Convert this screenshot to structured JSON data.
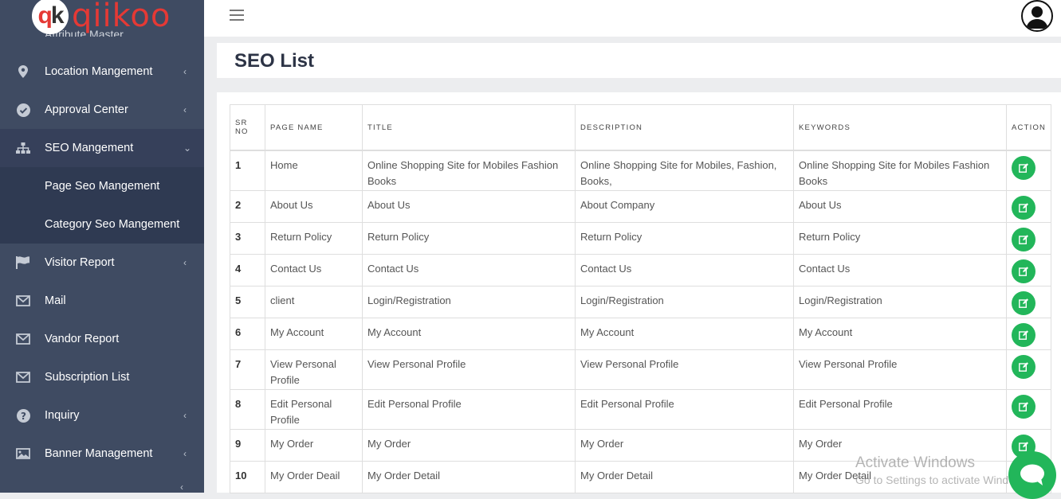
{
  "logo": {
    "text": "qiikoo",
    "mark_q": "q",
    "mark_k": "k",
    "hidden_item": "Attribute Master"
  },
  "sidebar": {
    "items": [
      {
        "label": "Location Mangement",
        "icon": "map-pin-icon",
        "chevron": "‹"
      },
      {
        "label": "Approval Center",
        "icon": "check-circle-icon",
        "chevron": "‹"
      },
      {
        "label": "SEO Mangement",
        "icon": "sitemap-icon",
        "chevron": "⌄"
      },
      {
        "label": "Page Seo Mangement"
      },
      {
        "label": "Category Seo Mangement"
      },
      {
        "label": "Visitor Report",
        "icon": "flag-icon",
        "chevron": "‹"
      },
      {
        "label": "Mail",
        "icon": "envelope-icon"
      },
      {
        "label": "Vandor Report",
        "icon": "envelope-icon"
      },
      {
        "label": "Subscription List",
        "icon": "envelope-icon"
      },
      {
        "label": "Inquiry",
        "icon": "question-circle-icon",
        "chevron": "‹"
      },
      {
        "label": "Banner Management",
        "icon": "image-icon",
        "chevron": "‹"
      }
    ],
    "bottom_chevron": "‹"
  },
  "page": {
    "title": "SEO List"
  },
  "table": {
    "headers": [
      "SR NO",
      "PAGE NAME",
      "TITLE",
      "DESCRIPTION",
      "KEYWORDS",
      "ACTION"
    ],
    "rows": [
      {
        "sr": "1",
        "page": "Home",
        "title": "Online Shopping Site for Mobiles Fashion Books",
        "desc": "Online Shopping Site for Mobiles, Fashion, Books,",
        "kw": "Online Shopping Site for Mobiles Fashion Books"
      },
      {
        "sr": "2",
        "page": "About Us",
        "title": "About Us",
        "desc": "About Company",
        "kw": "About Us"
      },
      {
        "sr": "3",
        "page": "Return Policy",
        "title": "Return Policy",
        "desc": "Return Policy",
        "kw": "Return Policy"
      },
      {
        "sr": "4",
        "page": "Contact Us",
        "title": "Contact Us",
        "desc": "Contact Us",
        "kw": "Contact Us"
      },
      {
        "sr": "5",
        "page": "client",
        "title": "Login/Registration",
        "desc": "Login/Registration",
        "kw": "Login/Registration"
      },
      {
        "sr": "6",
        "page": "My Account",
        "title": "My Account",
        "desc": "My Account",
        "kw": "My Account"
      },
      {
        "sr": "7",
        "page": "View Personal Profile",
        "title": "View Personal Profile",
        "desc": "View Personal Profile",
        "kw": "View Personal Profile"
      },
      {
        "sr": "8",
        "page": "Edit Personal Profile",
        "title": "Edit Personal Profile",
        "desc": "Edit Personal Profile",
        "kw": "Edit Personal Profile"
      },
      {
        "sr": "9",
        "page": "My Order",
        "title": "My Order",
        "desc": "My Order",
        "kw": "My Order"
      },
      {
        "sr": "10",
        "page": "My Order Deail",
        "title": "My Order Detail",
        "desc": "My Order Detail",
        "kw": "My Order Detail"
      }
    ]
  },
  "watermark": {
    "line1": "Activate Windows",
    "line2": "Go to Settings to activate Windows."
  },
  "colors": {
    "sidebar": "#3f4b62",
    "accent_green": "#22b65a",
    "logo_red": "#e53935"
  }
}
